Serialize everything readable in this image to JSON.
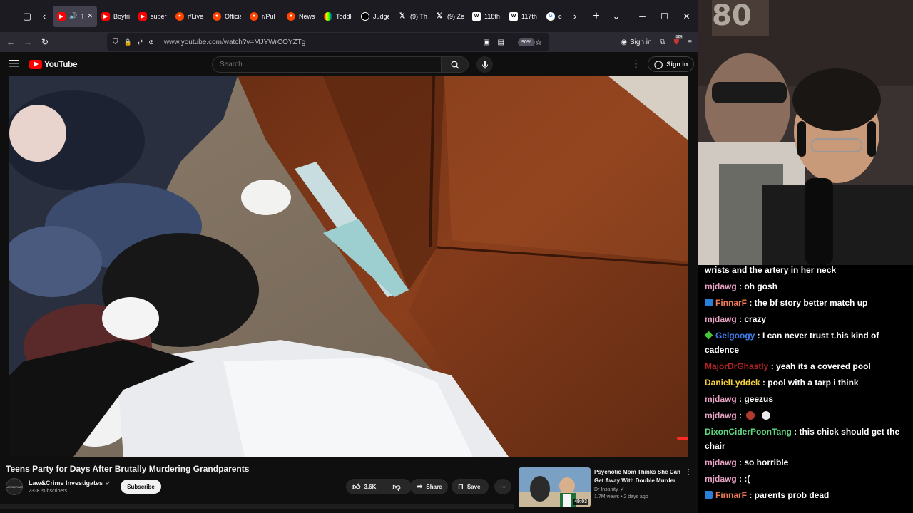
{
  "browser": {
    "tabs": [
      {
        "label": "Tee",
        "icon": "youtube-icon",
        "active": true
      },
      {
        "label": "Boyfri",
        "icon": "youtube-icon"
      },
      {
        "label": "super",
        "icon": "youtube-icon"
      },
      {
        "label": "r/Live",
        "icon": "reddit-icon"
      },
      {
        "label": "Officia",
        "icon": "reddit-icon"
      },
      {
        "label": "r/Pul",
        "icon": "reddit-icon"
      },
      {
        "label": "News",
        "icon": "reddit-icon"
      },
      {
        "label": "Toddle",
        "icon": "nbc-icon"
      },
      {
        "label": "Judge",
        "icon": "abc-icon"
      },
      {
        "label": "(9) Th",
        "icon": "x-icon"
      },
      {
        "label": "(9) Ze",
        "icon": "x-icon"
      },
      {
        "label": "118th",
        "icon": "wikipedia-icon"
      },
      {
        "label": "117th",
        "icon": "wikipedia-icon"
      },
      {
        "label": "co",
        "icon": "google-icon"
      }
    ],
    "url": "www.youtube.com/watch?v=MJYWrCOYZTg",
    "zoom": "90%",
    "sign_in": "Sign in",
    "extension_badge": "124"
  },
  "youtube": {
    "logo_text": "YouTube",
    "search_placeholder": "Search",
    "sign_in": "Sign in",
    "video": {
      "title": "Teens Party for Days After Brutally Murdering Grandparents",
      "channel": "Law&Crime Investigates",
      "subscribers": "233K subscribers",
      "subscribe_label": "Subscribe",
      "likes": "3.6K",
      "share_label": "Share",
      "save_label": "Save",
      "channel_avatar_text": "LAW&CRIME"
    },
    "related": {
      "title": "Psychotic Mom Thinks She Can Get Away With Double Murder",
      "channel": "Dr Insanity",
      "meta": "1.7M views • 2 days ago",
      "duration": "49:03"
    }
  },
  "chat": {
    "messages": [
      {
        "user": "",
        "color": "#ffffff",
        "badge": "",
        "text": "wrists and the artery in her neck"
      },
      {
        "user": "mjdawg",
        "color": "#e8a3c6",
        "badge": "",
        "text": "oh gosh"
      },
      {
        "user": "FinnarF",
        "color": "#f07b54",
        "badge": "mod",
        "text": "the bf story better match up"
      },
      {
        "user": "mjdawg",
        "color": "#e8a3c6",
        "badge": "",
        "text": "crazy"
      },
      {
        "user": "Gelgoogy",
        "color": "#3f7ff2",
        "badge": "diamond",
        "text": "I can never trust t.his kind of cadence"
      },
      {
        "user": "MajorDrGhastly",
        "color": "#b22222",
        "badge": "",
        "text": "yeah its a covered pool"
      },
      {
        "user": "DanielLyddek",
        "color": "#f4d03f",
        "badge": "",
        "text": "pool with a tarp i think"
      },
      {
        "user": "mjdawg",
        "color": "#e8a3c6",
        "badge": "",
        "text": "geezus"
      },
      {
        "user": "mjdawg",
        "color": "#e8a3c6",
        "badge": "",
        "text": ""
      },
      {
        "user": "DixonCiderPoonTang",
        "color": "#5fd97f",
        "badge": "",
        "text": "this chick should get the chair"
      },
      {
        "user": "mjdawg",
        "color": "#e8a3c6",
        "badge": "",
        "text": "so horrible"
      },
      {
        "user": "mjdawg",
        "color": "#e8a3c6",
        "badge": "",
        "text": ":("
      },
      {
        "user": "FinnarF",
        "color": "#f07b54",
        "badge": "mod",
        "text": "parents prob dead"
      }
    ]
  },
  "colors": {
    "youtube_red": "#ff0000",
    "browser_bg": "#1c1b22",
    "page_bg": "#0f0f0f"
  }
}
